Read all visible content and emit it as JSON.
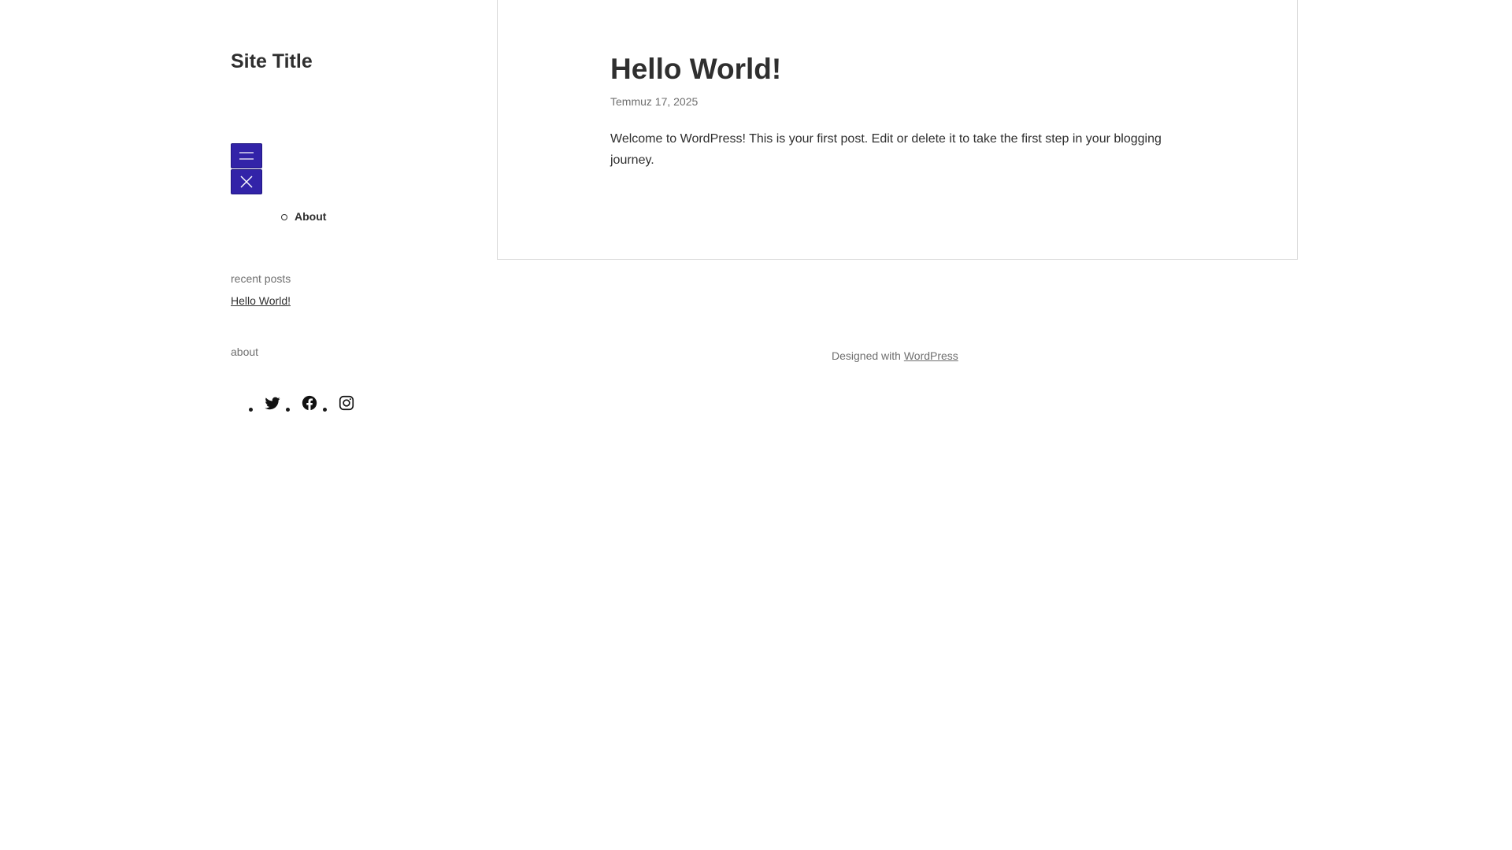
{
  "site": {
    "title": "Site Title"
  },
  "navigation": {
    "items": [
      {
        "label": "About"
      }
    ],
    "open_button_icon": "hamburger-icon",
    "close_button_icon": "close-icon",
    "button_color": "#3223a8"
  },
  "sidebar": {
    "recent_posts_heading": "recent posts",
    "recent_posts": [
      {
        "label": "Hello World!"
      }
    ],
    "about_heading": "about",
    "social_links": [
      {
        "icon": "twitter-icon"
      },
      {
        "icon": "facebook-icon"
      },
      {
        "icon": "instagram-icon"
      }
    ]
  },
  "post": {
    "title": "Hello World!",
    "date": "Temmuz 17, 2025",
    "body": "Welcome to WordPress! This is your first post. Edit or delete it to take the first step in your blogging journey."
  },
  "footer": {
    "prefix": "Designed with ",
    "link_label": "WordPress"
  }
}
